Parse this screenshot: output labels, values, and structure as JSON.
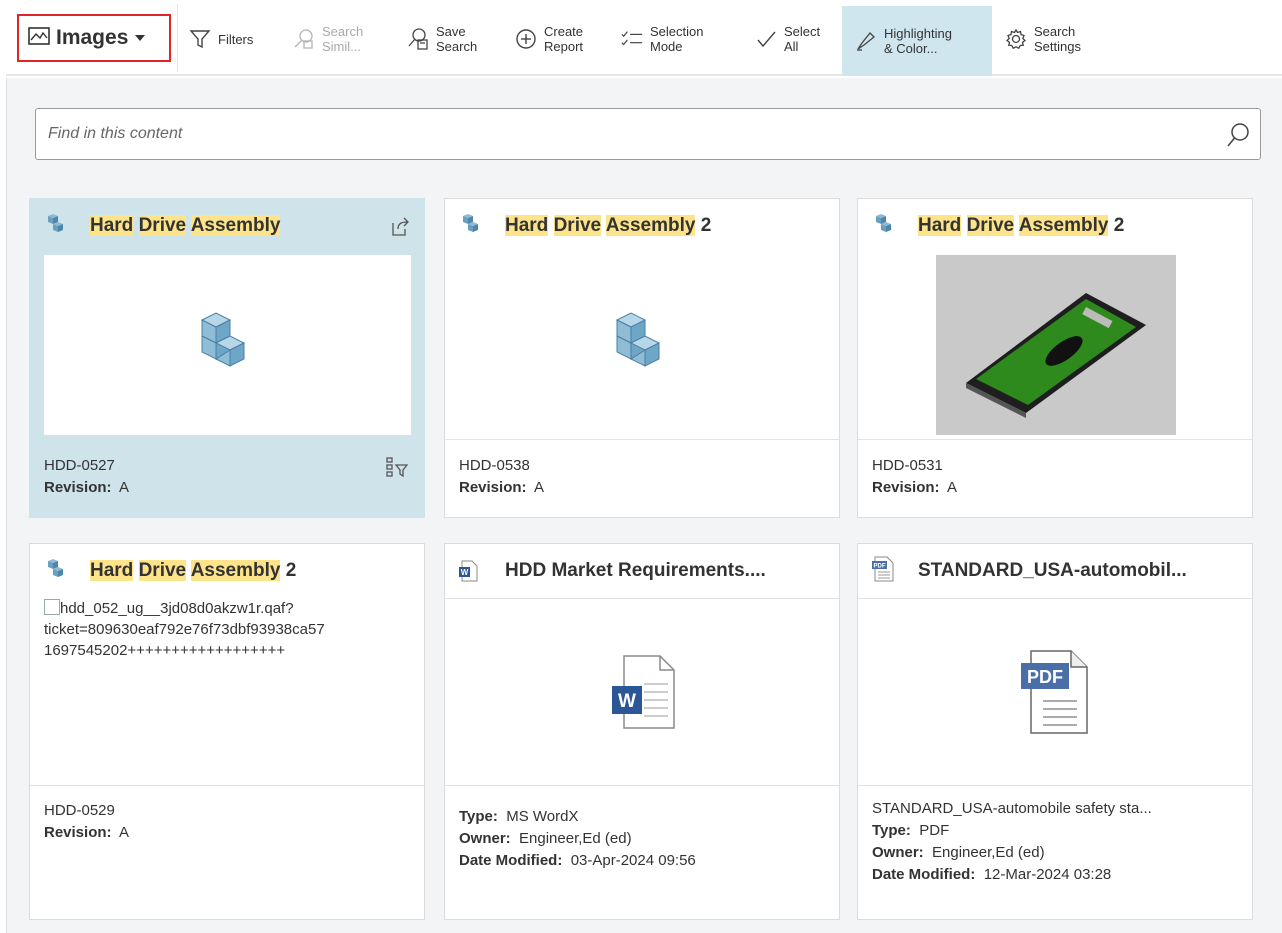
{
  "toolbar": {
    "view_label": "Images",
    "items": [
      {
        "label": "Filters"
      },
      {
        "label": "Search\nSimil..."
      },
      {
        "label": "Save\nSearch"
      },
      {
        "label": "Create\nReport"
      },
      {
        "label": "Selection\nMode"
      },
      {
        "label": "Select\nAll"
      },
      {
        "label": "Highlighting\n& Color..."
      },
      {
        "label": "Search\nSettings"
      }
    ]
  },
  "find": {
    "placeholder": "Find in this content"
  },
  "colors": {
    "highlight": "#fde48a",
    "selected": "#cfe3ea",
    "active_tool": "#cfe6ee",
    "red_box": "#e0242a"
  },
  "cards": [
    {
      "title_parts": [
        "Hard",
        "Drive",
        "Assembly"
      ],
      "suffix": "",
      "id": "HDD-0527",
      "rev_label": "Revision:",
      "rev": "A"
    },
    {
      "title_parts": [
        "Hard",
        "Drive",
        "Assembly"
      ],
      "suffix": " 2",
      "id": "HDD-0538",
      "rev_label": "Revision:",
      "rev": "A"
    },
    {
      "title_parts": [
        "Hard",
        "Drive",
        "Assembly"
      ],
      "suffix": " 2",
      "id": "HDD-0531",
      "rev_label": "Revision:",
      "rev": "A"
    },
    {
      "title_parts": [
        "Hard",
        "Drive",
        "Assembly"
      ],
      "suffix": " 2",
      "id": "HDD-0529",
      "rev_label": "Revision:",
      "rev": "A",
      "broken_text": [
        "hdd_052_ug__3jd08d0akzw1r.qaf?",
        "ticket=809630eaf792e76f73dbf93938ca57",
        "1697545202++++++++++++++++++"
      ]
    },
    {
      "title": "HDD Market Requirements....",
      "type_label": "Type:",
      "type": "MS WordX",
      "owner_label": "Owner:",
      "owner": "Engineer,Ed (ed)",
      "date_label": "Date Modified:",
      "date": "03-Apr-2024 09:56"
    },
    {
      "title": "STANDARD_USA-automobil...",
      "name": "STANDARD_USA-automobile safety sta...",
      "type_label": "Type:",
      "type": "PDF",
      "owner_label": "Owner:",
      "owner": "Engineer,Ed (ed)",
      "date_label": "Date Modified:",
      "date": "12-Mar-2024 03:28"
    }
  ],
  "icons": {
    "view": "image-icon",
    "filter": "funnel-icon",
    "search_similar": "search-similar-icon",
    "save": "save-search-icon",
    "report": "plus-circle-icon",
    "selection": "checklist-icon",
    "select_all": "checkmark-icon",
    "highlight": "highlighter-icon",
    "settings": "gear-icon",
    "part": "assembly-cubes-icon",
    "word": "word-document-icon",
    "pdf": "pdf-document-icon"
  }
}
